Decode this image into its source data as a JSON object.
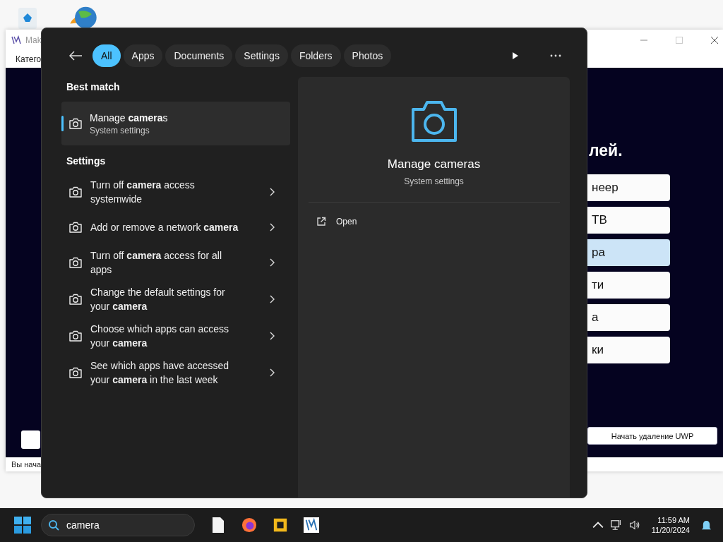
{
  "background_window": {
    "title": "Mak",
    "menu": "Катего",
    "heading": "лей.",
    "options": [
      {
        "label": "неер",
        "selected": false
      },
      {
        "label": "ТВ",
        "selected": false
      },
      {
        "label": "ра",
        "selected": true
      },
      {
        "label": "ти",
        "selected": false
      },
      {
        "label": "а",
        "selected": false
      },
      {
        "label": "ки",
        "selected": false
      }
    ],
    "action_button": "Начать удаление UWP",
    "status": "Вы нача"
  },
  "search": {
    "filters": [
      {
        "label": "All",
        "selected": true
      },
      {
        "label": "Apps",
        "selected": false
      },
      {
        "label": "Documents",
        "selected": false
      },
      {
        "label": "Settings",
        "selected": false
      },
      {
        "label": "Folders",
        "selected": false
      },
      {
        "label": "Photos",
        "selected": false
      }
    ],
    "best_match_heading": "Best match",
    "best_match": {
      "title": "Manage **camera**s",
      "subtitle": "System settings",
      "selected": true
    },
    "settings_heading": "Settings",
    "results": [
      "Turn off **camera** access systemwide",
      "Add or remove a network **camera**",
      "Turn off **camera** access for all apps",
      "Change the default settings for your **camera**",
      "Choose which apps can access your **camera**",
      "See which apps have accessed your **camera** in the last week"
    ],
    "preview": {
      "title": "Manage cameras",
      "subtitle": "System settings",
      "actions": [
        "Open"
      ]
    }
  },
  "taskbar": {
    "search_value": "camera",
    "time": "11:59 AM",
    "date": "11/20/2024"
  }
}
